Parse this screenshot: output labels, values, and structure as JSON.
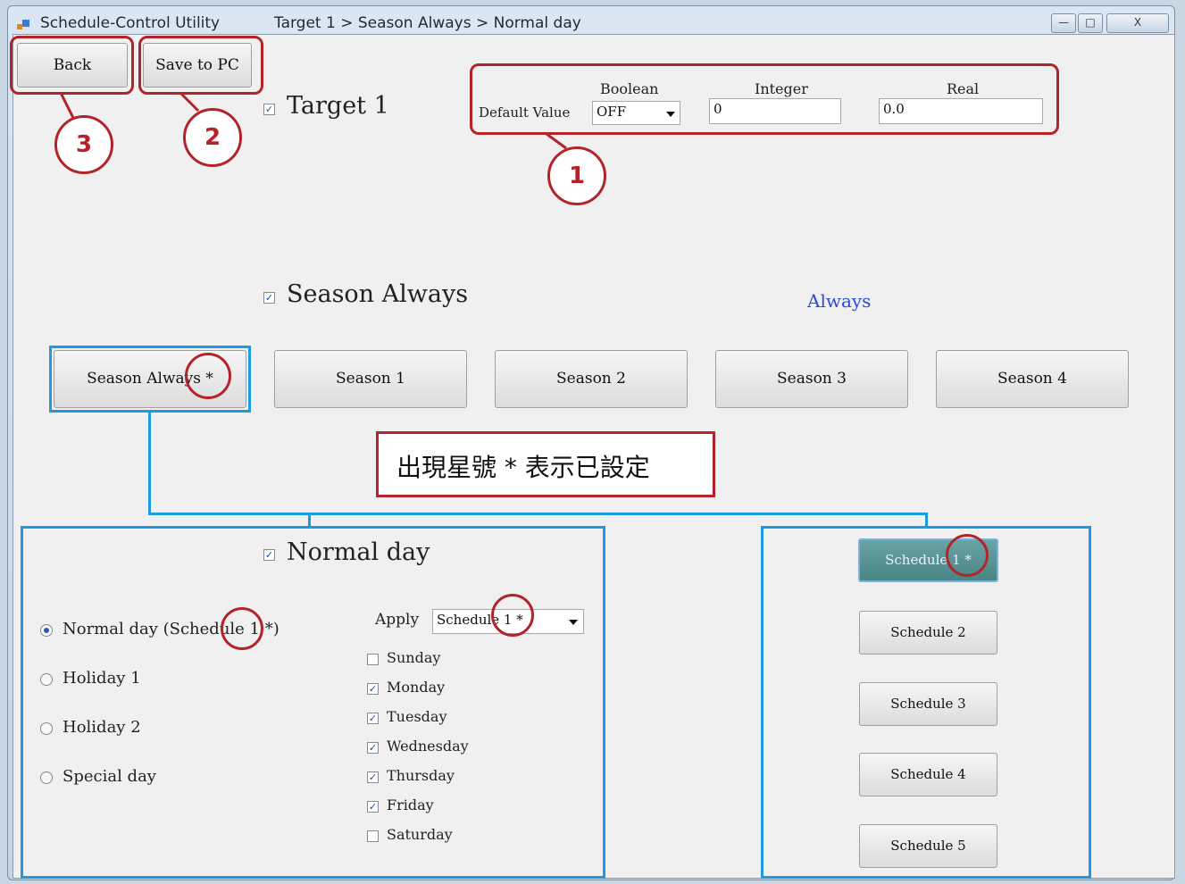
{
  "window": {
    "app_title": "Schedule-Control Utility",
    "breadcrumb": "Target 1 > Season Always > Normal day",
    "controls": [
      "—",
      "□",
      "X"
    ]
  },
  "toolbar": {
    "back_label": "Back",
    "save_label": "Save to PC"
  },
  "target": {
    "checked": true,
    "label": "Target 1"
  },
  "default_value": {
    "label": "Default Value",
    "boolean_header": "Boolean",
    "boolean_value": "OFF",
    "integer_header": "Integer",
    "integer_value": "0",
    "real_header": "Real",
    "real_value": "0.0"
  },
  "season": {
    "checked": true,
    "label": "Season Always",
    "mode": "Always"
  },
  "season_buttons": [
    "Season Always *",
    "Season 1",
    "Season 2",
    "Season 3",
    "Season 4"
  ],
  "note": "出現星號 * 表示已設定",
  "day": {
    "checked": true,
    "label": "Normal day"
  },
  "day_types": [
    {
      "label": "Normal day (Schedule 1 *)",
      "selected": true
    },
    {
      "label": "Holiday 1",
      "selected": false
    },
    {
      "label": "Holiday 2",
      "selected": false
    },
    {
      "label": "Special day",
      "selected": false
    }
  ],
  "apply": {
    "label": "Apply",
    "value": "Schedule 1 *"
  },
  "weekdays": [
    {
      "label": "Sunday",
      "checked": false
    },
    {
      "label": "Monday",
      "checked": true
    },
    {
      "label": "Tuesday",
      "checked": true
    },
    {
      "label": "Wednesday",
      "checked": true
    },
    {
      "label": "Thursday",
      "checked": true
    },
    {
      "label": "Friday",
      "checked": true
    },
    {
      "label": "Saturday",
      "checked": false
    }
  ],
  "schedules": [
    "Schedule 1 *",
    "Schedule 2",
    "Schedule 3",
    "Schedule 4",
    "Schedule 5"
  ],
  "annotations": [
    "1",
    "2",
    "3"
  ],
  "colors": {
    "heading_blue": "#2a4bd7",
    "annotation_red": "#b3242a",
    "highlight_blue": "#1e9be0",
    "active_teal": "#4a8585"
  }
}
